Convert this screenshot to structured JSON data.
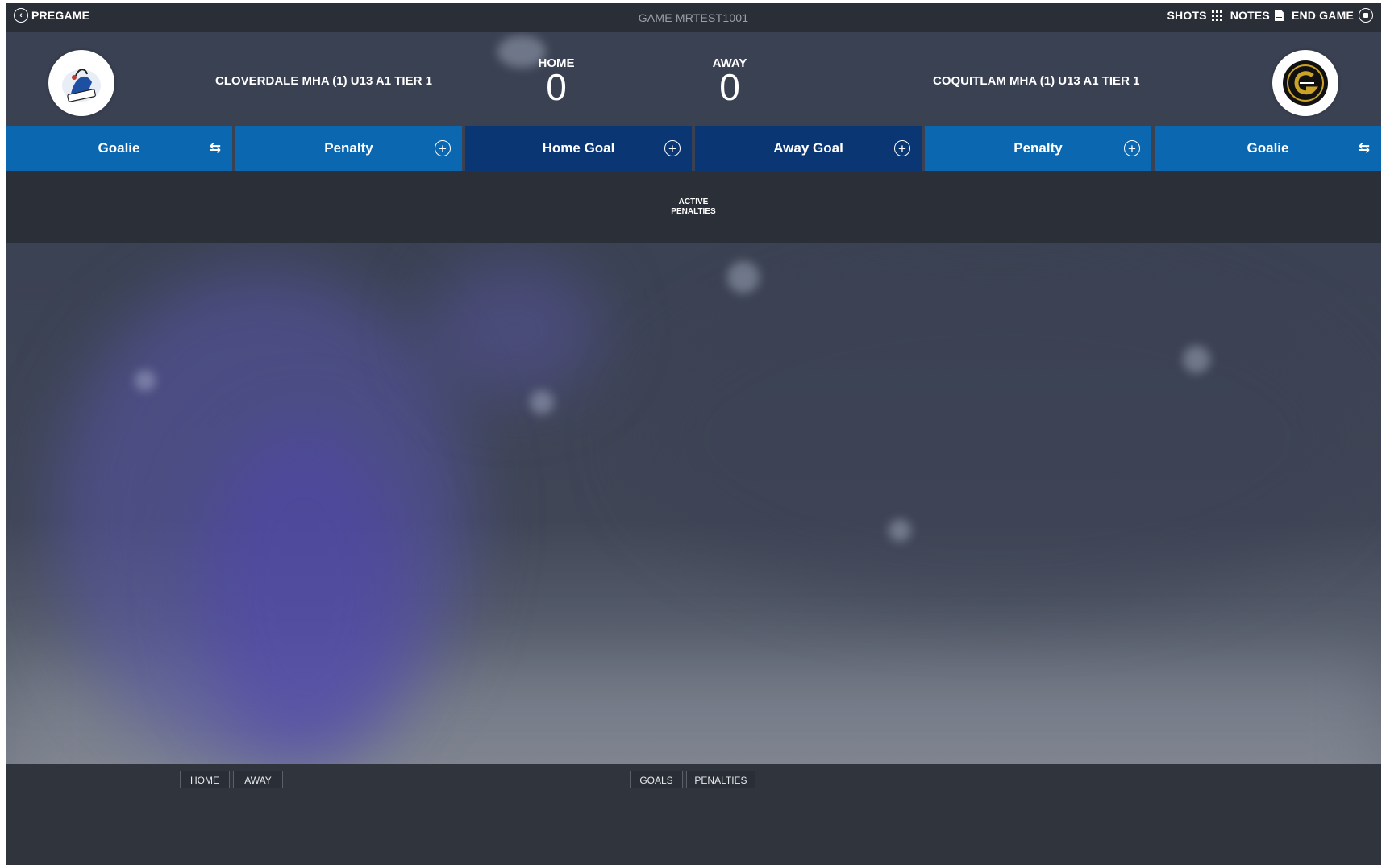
{
  "topbar": {
    "back_label": "PREGAME",
    "game_id": "GAME MRTEST1001",
    "shots_label": "SHOTS",
    "notes_label": "NOTES",
    "end_game_label": "END GAME"
  },
  "home": {
    "team_name": "CLOVERDALE MHA (1) U13 A1 TIER 1",
    "score_label": "HOME",
    "score": "0"
  },
  "away": {
    "team_name": "COQUITLAM MHA (1) U13 A1 TIER 1",
    "score_label": "AWAY",
    "score": "0"
  },
  "actions": [
    {
      "label": "Goalie",
      "icon": "swap-icon"
    },
    {
      "label": "Penalty",
      "icon": "plus-circle-icon"
    },
    {
      "label": "Home Goal",
      "icon": "plus-circle-icon"
    },
    {
      "label": "Away Goal",
      "icon": "plus-circle-icon"
    },
    {
      "label": "Penalty",
      "icon": "plus-circle-icon"
    },
    {
      "label": "Goalie",
      "icon": "swap-icon"
    }
  ],
  "penalties": {
    "line1": "ACTIVE",
    "line2": "PENALTIES"
  },
  "footer": {
    "team_tabs": [
      "HOME",
      "AWAY"
    ],
    "event_tabs": [
      "GOALS",
      "PENALTIES"
    ]
  },
  "colors": {
    "topbar": "#2a2e37",
    "action_blue": "#0a67b0",
    "goal_navy": "#0a3774",
    "panel": "#2b2f38"
  }
}
